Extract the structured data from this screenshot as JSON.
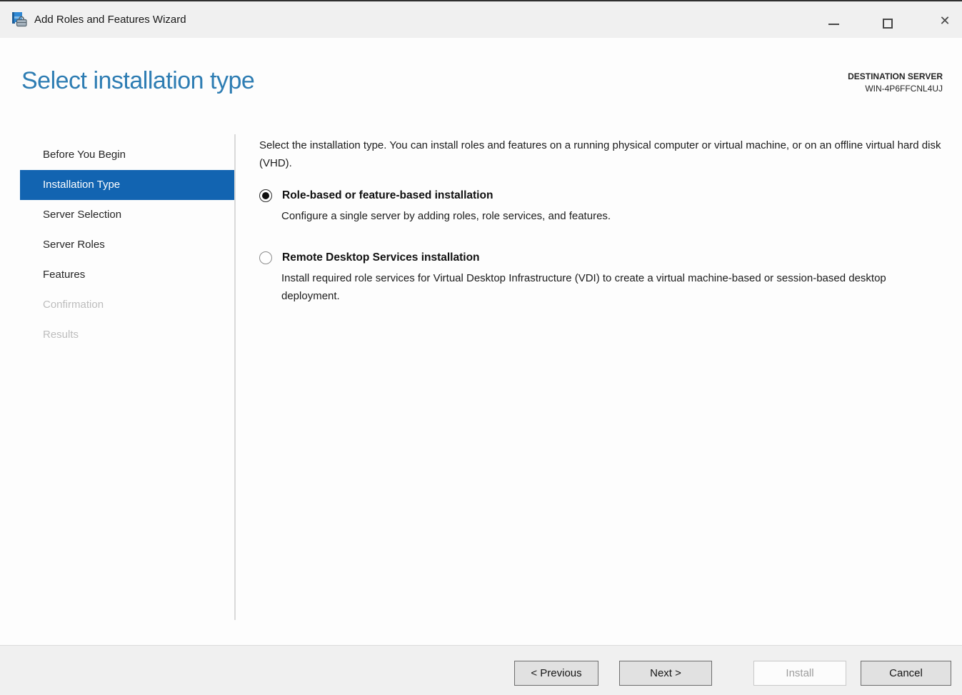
{
  "window": {
    "title": "Add Roles and Features Wizard",
    "app_icon": "server-manager-icon",
    "controls": [
      {
        "name": "minimize-button"
      },
      {
        "name": "maximize-button"
      },
      {
        "name": "close-button",
        "glyph": "✕"
      }
    ]
  },
  "header": {
    "title": "Select installation type",
    "destination_label": "DESTINATION SERVER",
    "destination_server": "WIN-4P6FFCNL4UJ"
  },
  "sidebar": {
    "items": [
      {
        "label": "Before You Begin",
        "state": "enabled"
      },
      {
        "label": "Installation Type",
        "state": "selected"
      },
      {
        "label": "Server Selection",
        "state": "enabled"
      },
      {
        "label": "Server Roles",
        "state": "enabled"
      },
      {
        "label": "Features",
        "state": "enabled"
      },
      {
        "label": "Confirmation",
        "state": "disabled"
      },
      {
        "label": "Results",
        "state": "disabled"
      }
    ]
  },
  "content": {
    "intro": "Select the installation type. You can install roles and features on a running physical computer or virtual machine, or on an offline virtual hard disk (VHD).",
    "options": [
      {
        "label": "Role-based or feature-based installation",
        "description": "Configure a single server by adding roles, role services, and features.",
        "selected": true
      },
      {
        "label": "Remote Desktop Services installation",
        "description": "Install required role services for Virtual Desktop Infrastructure (VDI) to create a virtual machine-based or session-based desktop deployment.",
        "selected": false
      }
    ]
  },
  "footer": {
    "buttons": [
      {
        "label": "< Previous",
        "enabled": true
      },
      {
        "label": "Next >",
        "enabled": true
      },
      {
        "label": "Install",
        "enabled": false
      },
      {
        "label": "Cancel",
        "enabled": true
      }
    ]
  },
  "colors": {
    "selection_blue": "#1264b1",
    "heading_blue": "#2e7db3",
    "titlebar_bg": "#f0f0f0",
    "content_bg": "#fdfdfd",
    "footer_bg": "#f0f0f0",
    "disabled_text": "#bdbdbd"
  }
}
